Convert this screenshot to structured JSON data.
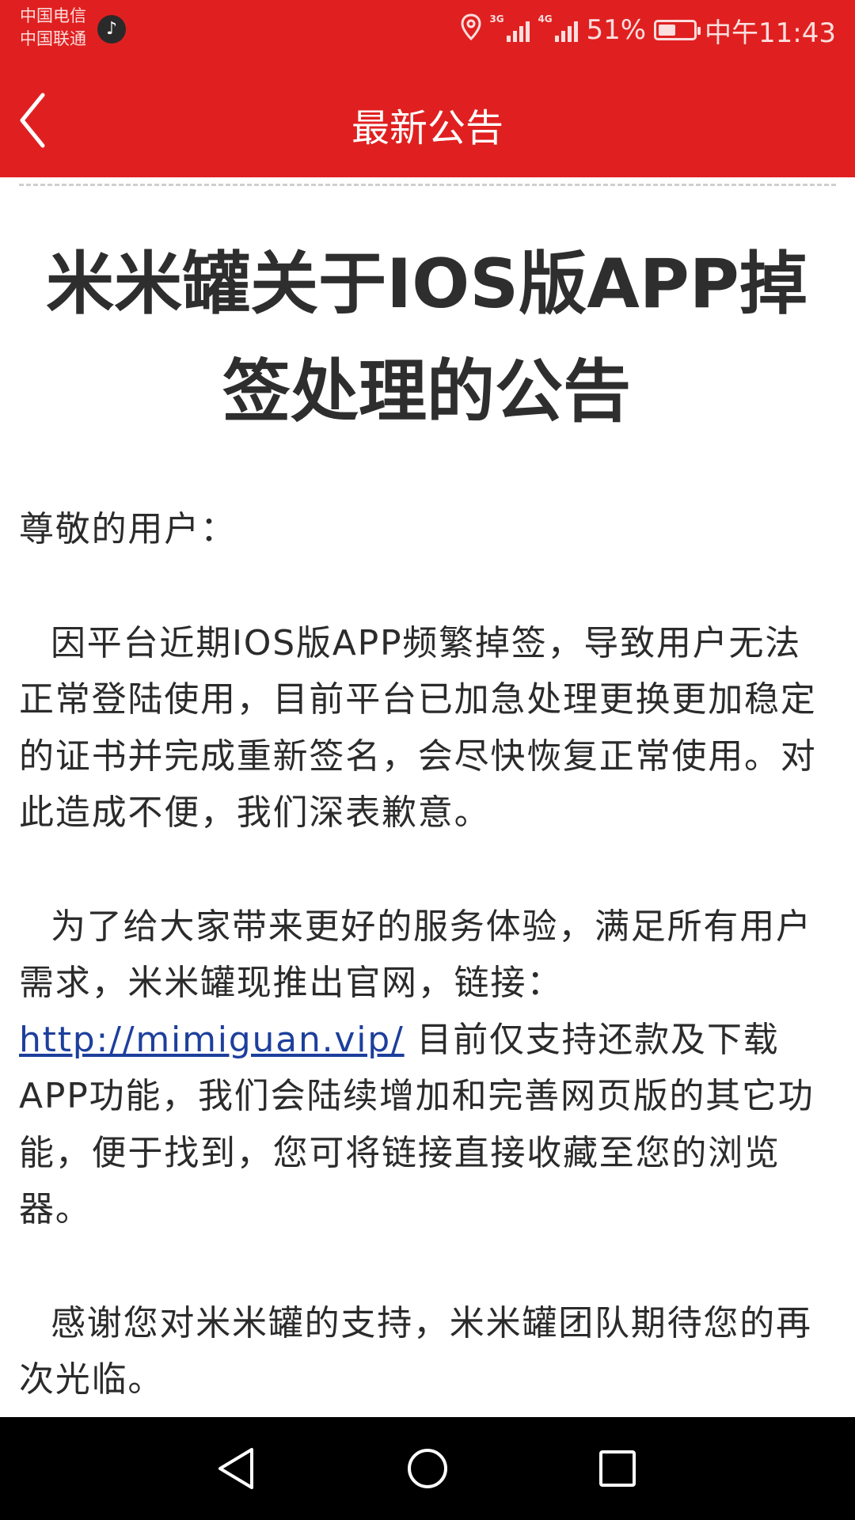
{
  "status_bar": {
    "carrier_1": "中国电信",
    "carrier_2": "中国联通",
    "net_1": "3G",
    "net_2": "4G",
    "battery": "51%",
    "battery_level": 0.51,
    "time": "中午11:43",
    "tiktok_icon": "♪"
  },
  "header": {
    "title": "最新公告"
  },
  "article": {
    "title": "米米罐关于IOS版APP掉签处理的公告",
    "greeting": "尊敬的用户：",
    "paragraph_1": "因平台近期IOS版APP频繁掉签，导致用户无法正常登陆使用，目前平台已加急处理更换更加稳定的证书并完成重新签名，会尽快恢复正常使用。对此造成不便，我们深表歉意。",
    "paragraph_2_before_link": "为了给大家带来更好的服务体验，满足所有用户需求，米米罐现推出官网，链接：",
    "link": "http://mimiguan.vip/",
    "paragraph_2_after_link": " 目前仅支持还款及下载APP功能，我们会陆续增加和完善网页版的其它功能，便于找到，您可将链接直接收藏至您的浏览器。",
    "paragraph_3": "感谢您对米米罐的支持，米米罐团队期待您的再次光临。"
  },
  "colors": {
    "accent": "#e02020",
    "link": "#1d3f9c"
  },
  "icons": [
    "location-icon",
    "signal-icon",
    "battery-icon",
    "back-chevron-icon",
    "nav-back-icon",
    "nav-home-icon",
    "nav-recents-icon"
  ]
}
